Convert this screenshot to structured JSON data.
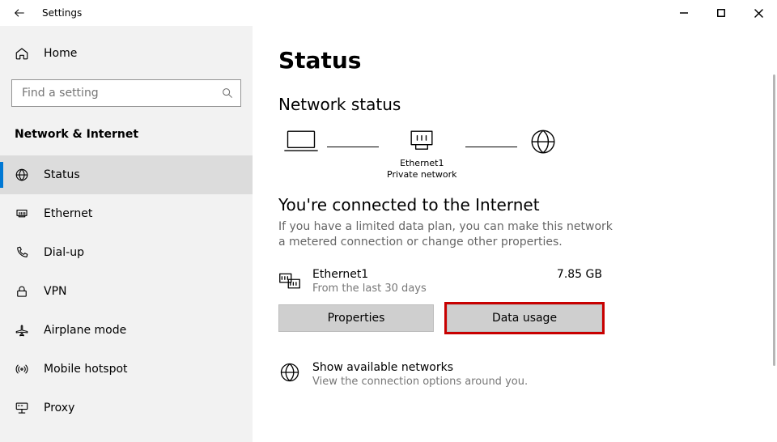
{
  "titlebar": {
    "title": "Settings"
  },
  "sidebar": {
    "home_label": "Home",
    "search_placeholder": "Find a setting",
    "category": "Network & Internet",
    "items": [
      {
        "label": "Status"
      },
      {
        "label": "Ethernet"
      },
      {
        "label": "Dial-up"
      },
      {
        "label": "VPN"
      },
      {
        "label": "Airplane mode"
      },
      {
        "label": "Mobile hotspot"
      },
      {
        "label": "Proxy"
      }
    ]
  },
  "main": {
    "page_title": "Status",
    "section_title": "Network status",
    "diagram": {
      "device_label": "",
      "adapter_label": "Ethernet1",
      "adapter_sub": "Private network",
      "internet_label": ""
    },
    "connected_title": "You're connected to the Internet",
    "connected_desc": "If you have a limited data plan, you can make this network a metered connection or change other properties.",
    "adapter": {
      "name": "Ethernet1",
      "sub": "From the last 30 days",
      "usage": "7.85 GB"
    },
    "buttons": {
      "properties": "Properties",
      "data_usage": "Data usage"
    },
    "show_networks": {
      "title": "Show available networks",
      "sub": "View the connection options around you."
    }
  }
}
